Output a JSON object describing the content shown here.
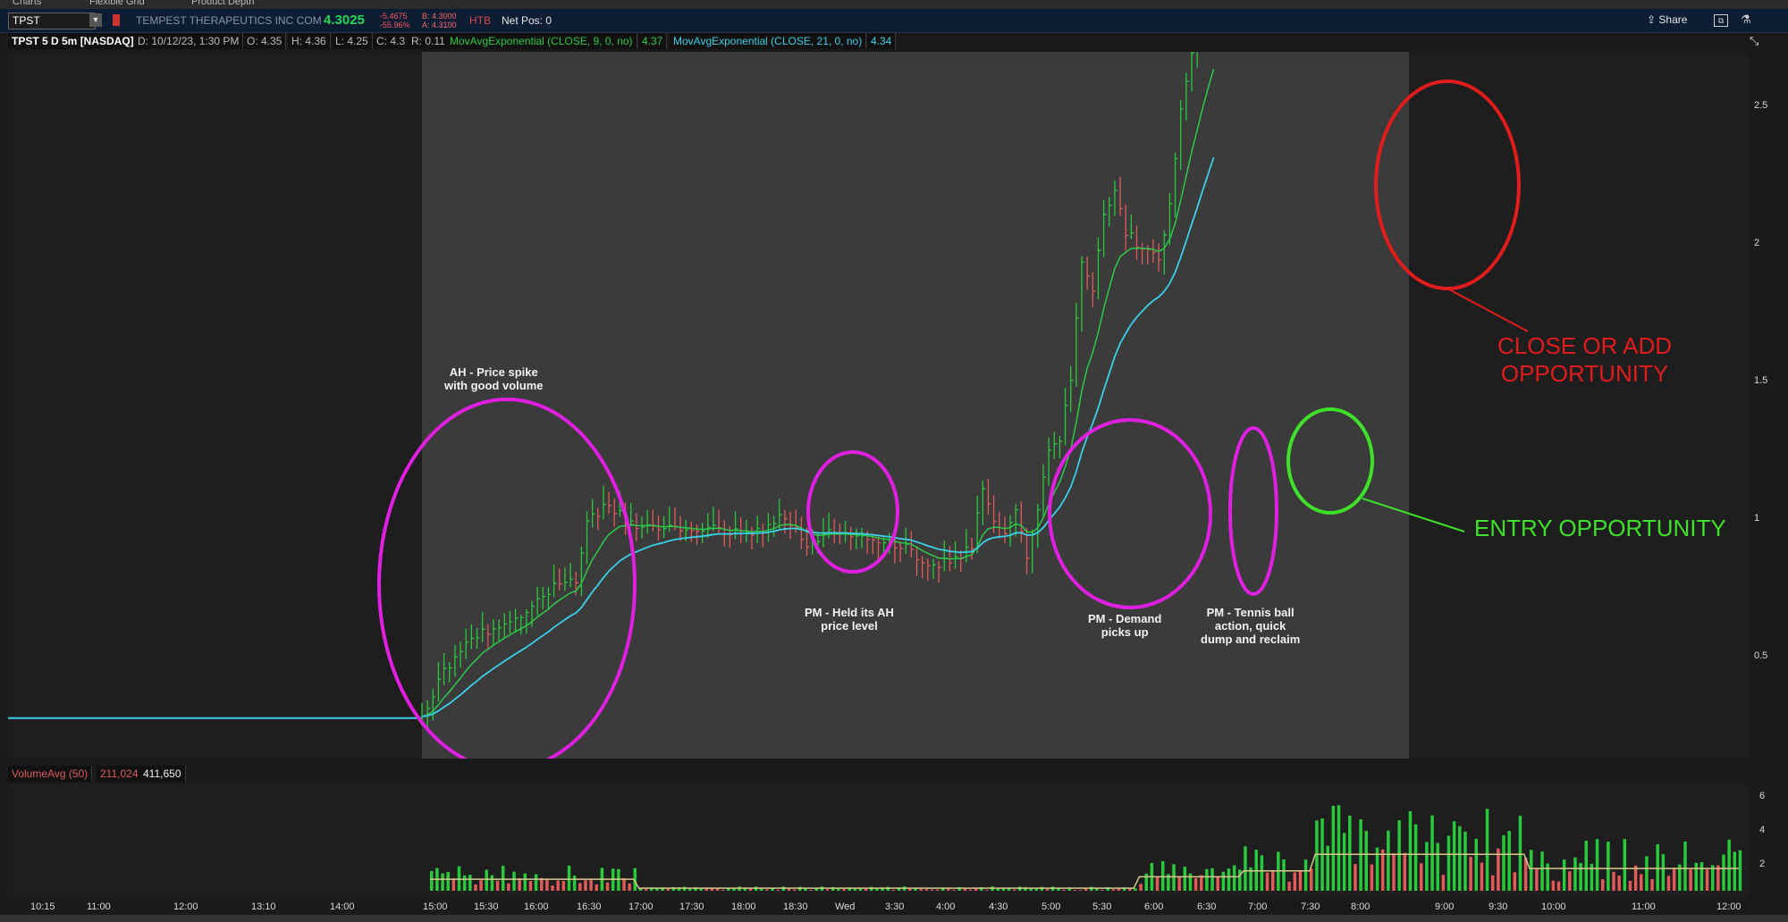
{
  "tabs": {
    "charts": "Charts",
    "flexible_grid": "Flexible Grid",
    "product_depth": "Product Depth"
  },
  "header": {
    "symbol": "TPST",
    "company": "TEMPEST THERAPEUTICS INC COM",
    "last": "4.3025",
    "change": "-5.4675",
    "change_pct": "-55.96%",
    "bid": "B: 4.3000",
    "ask": "A: 4.3100",
    "htb": "HTB",
    "net_pos": "Net Pos: 0",
    "share": "Share"
  },
  "study_bar": {
    "title": "TPST 5 D 5m [NASDAQ]",
    "date": "D: 10/12/23, 1:30 PM",
    "open": "O: 4.35",
    "high": "H: 4.36",
    "low": "L: 4.25",
    "close": "C: 4.3",
    "range": "R: 0.11",
    "ema9": "MovAvgExponential (CLOSE, 9, 0, no)",
    "ema9_val": "4.37",
    "ema21": "MovAvgExponential (CLOSE, 21, 0, no)",
    "ema21_val": "4.34"
  },
  "volume_bar": {
    "name": "VolumeAvg (50)",
    "avg": "211,024",
    "vol": "411,650"
  },
  "annotations": {
    "ah": [
      "AH - Price spike",
      "with good volume"
    ],
    "pm_held": [
      "PM - Held its AH",
      "price level"
    ],
    "pm_demand": [
      "PM - Demand",
      "picks up"
    ],
    "pm_tennis": [
      "PM - Tennis ball",
      "action, quick",
      "dump and reclaim"
    ],
    "entry": "ENTRY OPPORTUNITY",
    "close_add": [
      "CLOSE OR ADD",
      "OPPORTUNITY"
    ]
  },
  "colors": {
    "up": "#29c93c",
    "down": "#e05a5a",
    "ema9": "#2cc94a",
    "ema21": "#3ad0e8",
    "magenta": "#e020e0",
    "red": "#e01c1c",
    "green": "#3ee02a",
    "ext_hours": "#3b3b3b"
  },
  "chart_data": {
    "type": "candlestick",
    "y_ticks": [
      "2.5",
      "2",
      "1.5",
      "1",
      "0.5"
    ],
    "ylim": [
      0.25,
      2.75
    ],
    "vol_ticks": [
      "6",
      "4",
      "2"
    ],
    "x_ticks": [
      "10:15",
      "11:00",
      "12:00",
      "13:10",
      "14:00",
      "15:00",
      "15:30",
      "16:00",
      "16:30",
      "17:00",
      "17:30",
      "18:00",
      "18:30",
      "Wed",
      "3:30",
      "4:00",
      "4:30",
      "5:00",
      "5:30",
      "6:00",
      "6:30",
      "7:00",
      "7:30",
      "8:00",
      "9:00",
      "9:30",
      "10:00",
      "11:00",
      "12:00"
    ],
    "series": [
      {
        "name": "MovAvgExponential (CLOSE, 9, 0, no)",
        "value": 4.37
      },
      {
        "name": "MovAvgExponential (CLOSE, 21, 0, no)",
        "value": 4.34
      },
      {
        "name": "VolumeAvg (50)",
        "value": 211024
      }
    ],
    "price_path": [
      [
        0,
        0.28
      ],
      [
        15,
        0.28
      ],
      [
        18,
        0.28
      ],
      [
        20,
        0.45
      ],
      [
        22,
        0.55
      ],
      [
        24,
        0.6
      ],
      [
        26,
        0.63
      ],
      [
        28,
        0.7
      ],
      [
        30,
        0.75
      ],
      [
        32,
        0.78
      ],
      [
        33,
        1.0
      ],
      [
        35,
        1.05
      ],
      [
        37,
        0.98
      ],
      [
        39,
        0.97
      ],
      [
        41,
        0.96
      ],
      [
        43,
        0.97
      ],
      [
        45,
        0.96
      ],
      [
        47,
        0.95
      ],
      [
        49,
        0.97
      ],
      [
        51,
        1.02
      ],
      [
        53,
        0.9
      ],
      [
        55,
        0.95
      ],
      [
        58,
        0.95
      ],
      [
        60,
        0.93
      ],
      [
        62,
        0.9
      ],
      [
        64,
        0.85
      ],
      [
        66,
        0.84
      ],
      [
        68,
        0.9
      ],
      [
        69,
        1.12
      ],
      [
        70,
        1.0
      ],
      [
        71,
        0.95
      ],
      [
        72,
        1.05
      ],
      [
        73,
        0.88
      ],
      [
        74,
        1.05
      ],
      [
        75,
        1.25
      ],
      [
        76,
        1.3
      ],
      [
        77,
        1.5
      ],
      [
        78,
        1.95
      ],
      [
        79,
        1.85
      ],
      [
        80,
        2.1
      ],
      [
        81,
        2.2
      ],
      [
        82,
        2.05
      ],
      [
        83,
        2.0
      ],
      [
        84,
        2.0
      ],
      [
        85,
        1.95
      ],
      [
        86,
        2.15
      ],
      [
        87,
        2.5
      ],
      [
        88,
        2.7
      ],
      [
        89,
        2.8
      ],
      [
        90,
        2.9
      ]
    ]
  }
}
